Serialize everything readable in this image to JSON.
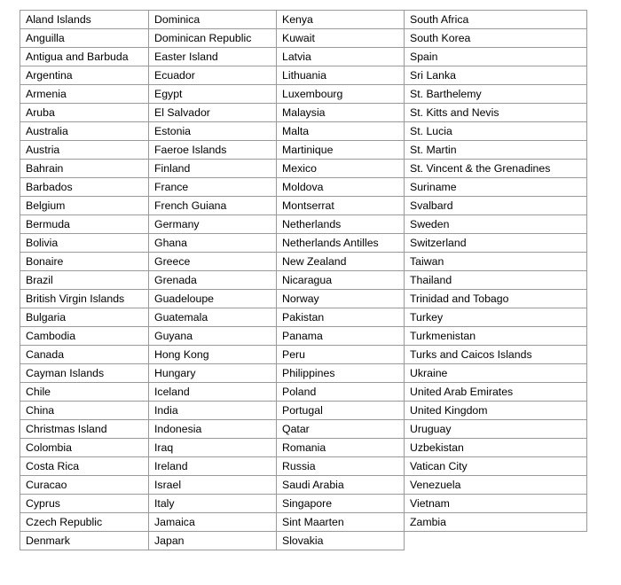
{
  "document": {
    "type": "table",
    "column_count": 4,
    "row_count": 30,
    "border_color": "#9a9a9a",
    "text_color": "#000000",
    "background_color": "#ffffff"
  },
  "table": {
    "rows": [
      [
        "Aland Islands",
        "Dominica",
        "Kenya",
        "South Africa"
      ],
      [
        "Anguilla",
        "Dominican Republic",
        "Kuwait",
        "South Korea"
      ],
      [
        "Antigua and Barbuda",
        "Easter Island",
        "Latvia",
        "Spain"
      ],
      [
        "Argentina",
        "Ecuador",
        "Lithuania",
        "Sri Lanka"
      ],
      [
        "Armenia",
        "Egypt",
        "Luxembourg",
        "St. Barthelemy"
      ],
      [
        "Aruba",
        "El Salvador",
        "Malaysia",
        "St. Kitts and Nevis"
      ],
      [
        "Australia",
        "Estonia",
        "Malta",
        "St. Lucia"
      ],
      [
        "Austria",
        "Faeroe Islands",
        "Martinique",
        "St. Martin"
      ],
      [
        "Bahrain",
        "Finland",
        "Mexico",
        "St. Vincent & the Grenadines"
      ],
      [
        "Barbados",
        "France",
        "Moldova",
        "Suriname"
      ],
      [
        "Belgium",
        "French Guiana",
        "Montserrat",
        "Svalbard"
      ],
      [
        "Bermuda",
        "Germany",
        "Netherlands",
        "Sweden"
      ],
      [
        "Bolivia",
        "Ghana",
        "Netherlands Antilles",
        "Switzerland"
      ],
      [
        "Bonaire",
        "Greece",
        "New Zealand",
        "Taiwan"
      ],
      [
        "Brazil",
        "Grenada",
        "Nicaragua",
        "Thailand"
      ],
      [
        "British Virgin Islands",
        "Guadeloupe",
        "Norway",
        "Trinidad and Tobago"
      ],
      [
        "Bulgaria",
        "Guatemala",
        "Pakistan",
        "Turkey"
      ],
      [
        "Cambodia",
        "Guyana",
        "Panama",
        "Turkmenistan"
      ],
      [
        "Canada",
        "Hong Kong",
        "Peru",
        "Turks and Caicos Islands"
      ],
      [
        "Cayman Islands",
        "Hungary",
        "Philippines",
        "Ukraine"
      ],
      [
        "Chile",
        "Iceland",
        "Poland",
        "United Arab Emirates"
      ],
      [
        "China",
        "India",
        "Portugal",
        "United Kingdom"
      ],
      [
        "Christmas Island",
        "Indonesia",
        "Qatar",
        "Uruguay"
      ],
      [
        "Colombia",
        "Iraq",
        "Romania",
        "Uzbekistan"
      ],
      [
        "Costa Rica",
        "Ireland",
        "Russia",
        "Vatican City"
      ],
      [
        "Curacao",
        "Israel",
        "Saudi Arabia",
        "Venezuela"
      ],
      [
        "Cyprus",
        "Italy",
        "Singapore",
        "Vietnam"
      ],
      [
        "Czech Republic",
        "Jamaica",
        "Sint Maarten",
        "Zambia"
      ],
      [
        "Denmark",
        "Japan",
        "Slovakia",
        ""
      ]
    ]
  }
}
